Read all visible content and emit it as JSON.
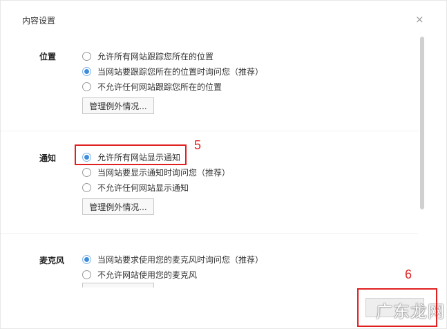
{
  "dialog": {
    "title": "内容设置",
    "close_glyph": "×"
  },
  "location": {
    "label": "位置",
    "options": [
      {
        "label": "允许所有网站跟踪您所在的位置",
        "checked": false
      },
      {
        "label": "当网站要跟踪您所在的位置时询问您（推荐）",
        "checked": true
      },
      {
        "label": "不允许任何网站跟踪您所在的位置",
        "checked": false
      }
    ],
    "manage_button": "管理例外情况..."
  },
  "notifications": {
    "label": "通知",
    "options": [
      {
        "label": "允许所有网站显示通知",
        "checked": true
      },
      {
        "label": "当网站要显示通知时询问您（推荐）",
        "checked": false
      },
      {
        "label": "不允许任何网站显示通知",
        "checked": false
      }
    ],
    "manage_button": "管理例外情况..."
  },
  "microphone": {
    "label": "麦克风",
    "options": [
      {
        "label": "当网站要求使用您的麦克风时询问您（推荐）",
        "checked": true
      },
      {
        "label": "不允许网站使用您的麦克风",
        "checked": false
      }
    ]
  },
  "annotations": {
    "step5": "5",
    "step6": "6"
  },
  "watermark": "广东龙网",
  "colors": {
    "accent": "#3e8ddd",
    "annotation": "#e02020"
  }
}
